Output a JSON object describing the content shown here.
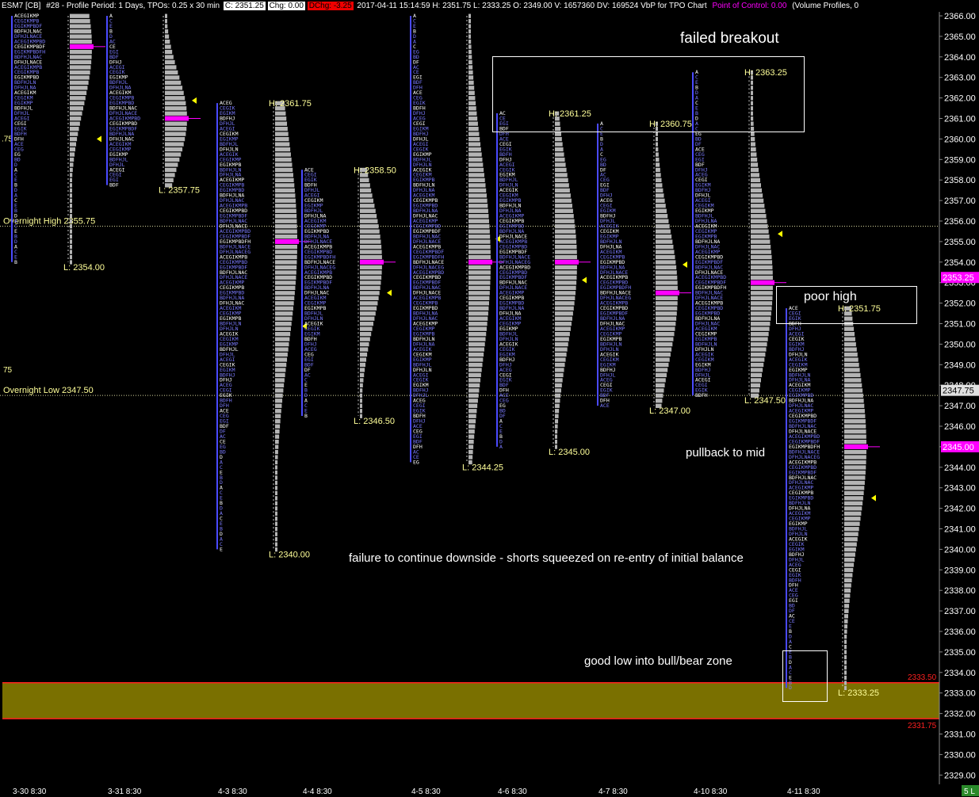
{
  "header": {
    "symbol": "ESM7 [CB]",
    "info": "#28 - Profile Period: 1 Days, TPOs: 0.25 x 30 min",
    "close": "C: 2351.25",
    "change": "Chg: 0.00",
    "dchange": "DChg: -3.25",
    "stats": "2017-04-11 15:14:59 H: 2351.75 L: 2333.25 O: 2349.00 V: 1657360 DV: 169524 VbP for TPO Chart",
    "poc": "Point of Control: 0.00",
    "tail": "(Volume Profiles, 0"
  },
  "colors": {
    "tpo_blue": "#7b7bff",
    "tpo_white": "#ffffff",
    "volume_gray": "#b4b4b4",
    "poc_magenta": "#ff00ff",
    "label_yellow": "#ffff99",
    "zone_fill": "#7a7000",
    "zone_line": "#ff2020",
    "axis_text": "#ffffff"
  },
  "annotations": {
    "failed_breakout": "failed breakout",
    "poor_high": "poor high",
    "pullback": "pullback to mid",
    "failure": "failure to continue downside - shorts squeezed on re-entry of initial balance",
    "good_low": "good low into bull/bear zone"
  },
  "chart_data": {
    "type": "tpo_profile",
    "y_axis": {
      "min": 2329,
      "max": 2366,
      "step": 1,
      "tick_labels": [
        "2366.00",
        "2365.00",
        "2364.00",
        "2363.00",
        "2362.00",
        "2361.00",
        "2360.00",
        "2359.00",
        "2358.00",
        "2357.00",
        "2356.00",
        "2355.00",
        "2354.00",
        "2353.00",
        "2352.00",
        "2351.00",
        "2350.00",
        "2349.00",
        "2348.00",
        "2347.00",
        "2346.00",
        "2345.00",
        "2344.00",
        "2343.00",
        "2342.00",
        "2341.00",
        "2340.00",
        "2339.00",
        "2338.00",
        "2337.00",
        "2336.00",
        "2335.00",
        "2334.00",
        "2333.00",
        "2332.00",
        "2331.00",
        "2330.00",
        "2329.00"
      ]
    },
    "x_labels": [
      "3-30  8:30",
      "3-31  8:30",
      "4-3  8:30",
      "4-4  8:30",
      "4-5  8:30",
      "4-6  8:30",
      "4-7  8:30",
      "4-10  8:30",
      "4-11  8:30"
    ],
    "sessions": [
      {
        "date": "3-30",
        "high": 2366.0,
        "low": 2354.0,
        "poc": 2364.5,
        "low_label": "L: 2354.00"
      },
      {
        "date": "3-31",
        "high": 2366.0,
        "low": 2357.75,
        "poc": 2361.0,
        "low_label": "L: 2357.75"
      },
      {
        "date": "4-3",
        "high": 2361.75,
        "low": 2340.0,
        "poc": 2355.0,
        "high_label": "H: 2361.75",
        "low_label": "L: 2340.00"
      },
      {
        "date": "4-4",
        "high": 2358.5,
        "low": 2346.5,
        "poc": 2354.0,
        "high_label": "H: 2358.50",
        "low_label": "L: 2346.50"
      },
      {
        "date": "4-5",
        "high": 2366.0,
        "low": 2344.25,
        "poc": 2354.0,
        "low_label": "L: 2344.25"
      },
      {
        "date": "4-6",
        "high": 2361.25,
        "low": 2345.0,
        "poc": 2354.0,
        "high_label": "H: 2361.25",
        "low_label": "L: 2345.00"
      },
      {
        "date": "4-7",
        "high": 2360.75,
        "low": 2347.0,
        "poc": 2352.5,
        "high_label": "H: 2360.75",
        "low_label": "L: 2347.00"
      },
      {
        "date": "4-10",
        "high": 2363.25,
        "low": 2347.5,
        "poc": 2353.0,
        "high_label": "H: 2363.25",
        "low_label": "L: 2347.50"
      },
      {
        "date": "4-11",
        "high": 2351.75,
        "low": 2333.25,
        "poc": 2345.0,
        "high_label": "H: 2351.75",
        "low_label": "L: 2333.25"
      }
    ],
    "reference_lines": [
      {
        "name": "Overnight High",
        "value": 2355.75,
        "label": "Overnight High  2355.75"
      },
      {
        "name": "Overnight Low",
        "value": 2347.5,
        "label": "Overnight Low  2347.50"
      }
    ],
    "zone": {
      "top": 2333.5,
      "bottom": 2331.75,
      "top_label": "2333.50",
      "bottom_label": "2331.75"
    },
    "price_tags": [
      {
        "value": 2353.25,
        "label": "2353.25",
        "style": "magenta"
      },
      {
        "value": 2347.75,
        "label": "2347.75",
        "style": "white"
      },
      {
        "value": 2345.0,
        "label": "2345.00",
        "style": "magenta"
      }
    ],
    "left_edge_labels": [
      ".75",
      "75"
    ],
    "corner_badge": "5 L"
  }
}
